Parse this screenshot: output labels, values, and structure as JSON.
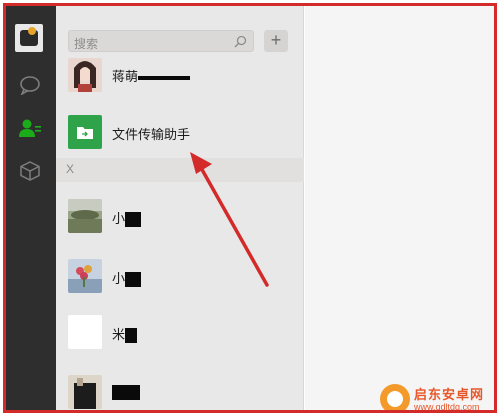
{
  "search": {
    "placeholder": "搜索"
  },
  "toolbar": {
    "add_label": "+"
  },
  "contacts": {
    "top": {
      "name": "蒋萌"
    },
    "file_helper": {
      "name": "文件传输助手"
    },
    "section_letter": "X",
    "items": [
      {
        "name": "小"
      },
      {
        "name": "小"
      },
      {
        "name": "米"
      },
      {
        "name": ""
      }
    ]
  },
  "watermark": {
    "title": "启东安卓网",
    "url": "www.qdltdq.com"
  },
  "colors": {
    "rail": "#2e2e2e",
    "list_bg": "#e9e8e8",
    "file_helper": "#2fa34a",
    "annotation": "#d32a2a",
    "active_icon": "#1aad19"
  },
  "icons": [
    "chat-icon",
    "contacts-icon",
    "favorites-icon",
    "search-icon",
    "folder-icon"
  ]
}
